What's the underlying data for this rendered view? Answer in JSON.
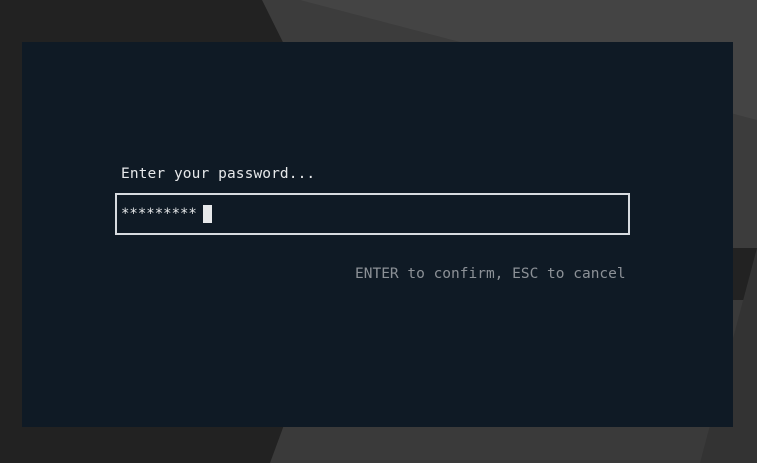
{
  "prompt": {
    "label": "Enter your password...",
    "masked_value": "*********",
    "hint": "ENTER to confirm, ESC to cancel"
  },
  "colors": {
    "dialog_background": "#0f1a25",
    "text": "#e6e8ea",
    "hint_text": "#8c9197",
    "input_border": "#d7dbe0"
  }
}
